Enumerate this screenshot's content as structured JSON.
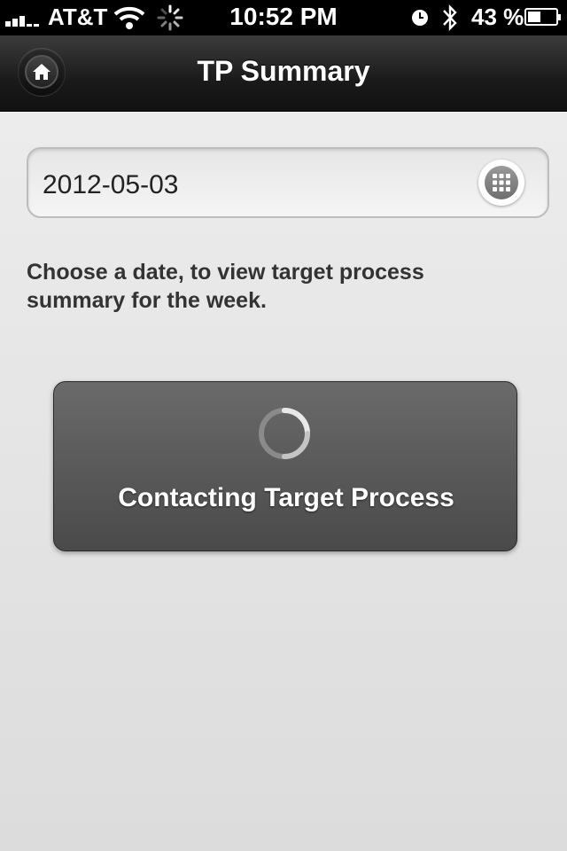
{
  "status_bar": {
    "carrier": "AT&T",
    "time": "10:52 PM",
    "battery_percent": "43 %",
    "icons": [
      "signal-icon",
      "wifi-icon",
      "activity-spinner-icon",
      "alarm-clock-icon",
      "bluetooth-icon",
      "battery-icon"
    ]
  },
  "nav_bar": {
    "title": "TP Summary",
    "home_icon": "home-icon"
  },
  "date_picker": {
    "value": "2012-05-03",
    "icon": "calendar-grid-icon"
  },
  "hint_text": "Choose a date, to view target process summary for the week.",
  "loading": {
    "message": "Contacting Target Process",
    "icon": "loading-spinner-icon"
  },
  "colors": {
    "nav_background": "#1a1a1a",
    "content_background": "#e4e4e4",
    "loader_background": "#5a5a5a"
  }
}
